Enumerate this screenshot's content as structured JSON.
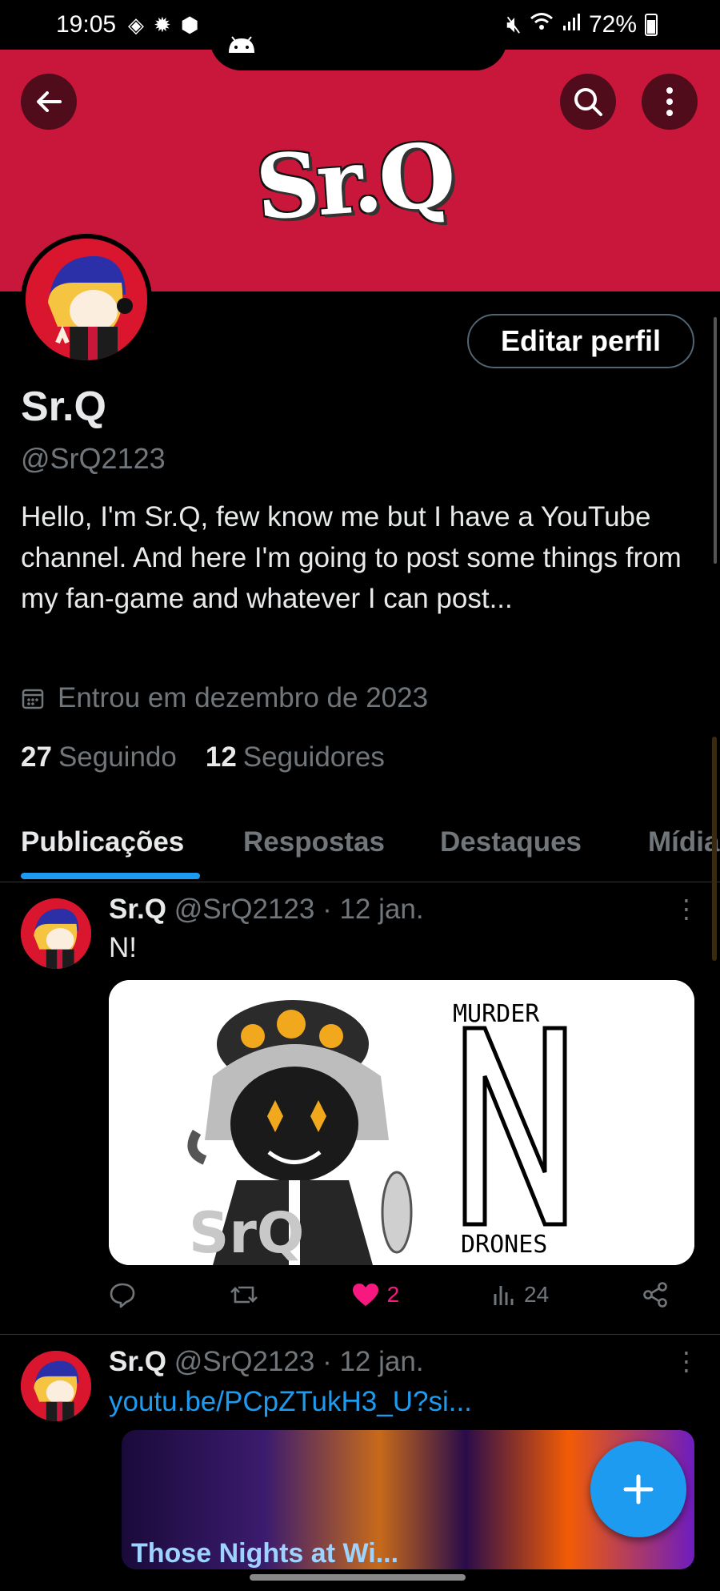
{
  "status_bar": {
    "time": "19:05",
    "battery": "72%"
  },
  "banner": {
    "logo_text": "Sr.Q"
  },
  "profile": {
    "edit_button": "Editar perfil",
    "display_name": "Sr.Q",
    "handle": "@SrQ2123",
    "bio": "Hello, I'm Sr.Q, few know me but I have a YouTube channel. And here I'm going to post some things from my fan-game and whatever I can post...",
    "joined": "Entrou em dezembro de 2023",
    "following_count": "27",
    "following_label": "Seguindo",
    "followers_count": "12",
    "followers_label": "Seguidores"
  },
  "tabs": [
    {
      "label": "Publicações",
      "active": true
    },
    {
      "label": "Respostas"
    },
    {
      "label": "Destaques"
    },
    {
      "label": "Mídia"
    }
  ],
  "posts": [
    {
      "name": "Sr.Q",
      "handle": "@SrQ2123",
      "date": "· 12 jan.",
      "text": "N!",
      "media_text_top": "MURDER",
      "media_text_bottom": "DRONES",
      "media_watermark": "SrQ",
      "likes": "2",
      "views": "24"
    },
    {
      "name": "Sr.Q",
      "handle": "@SrQ2123",
      "date": "· 12 jan.",
      "link": "youtu.be/PCpZTukH3_U?si...",
      "thumb_text": "Those Nights at Wi..."
    }
  ],
  "colors": {
    "banner": "#c8173a",
    "accent": "#1d9bf0",
    "like": "#f91880"
  }
}
